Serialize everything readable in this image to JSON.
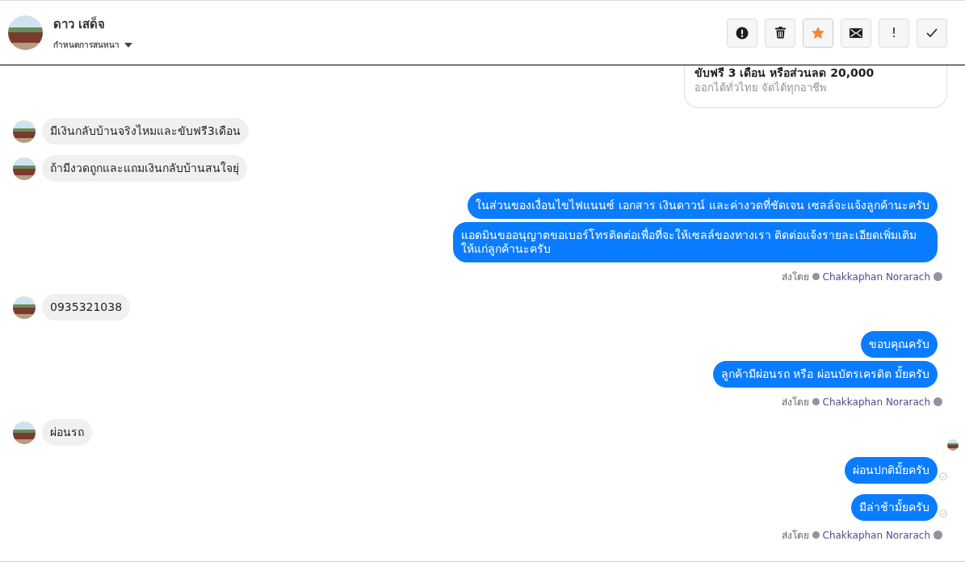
{
  "header": {
    "name": "ดาว เสด็จ",
    "subtitle": "กำหนดการสนทนา",
    "actions": [
      {
        "kind": "alert",
        "on": false
      },
      {
        "kind": "delete",
        "on": false
      },
      {
        "kind": "star",
        "on": true
      },
      {
        "kind": "mail",
        "on": false
      },
      {
        "kind": "important",
        "label": "!",
        "on": false
      },
      {
        "kind": "done",
        "on": false
      }
    ]
  },
  "messages": [
    {
      "kind": "card",
      "title": "ขับฟรี 3 เดือน หรือส่วนลด 20,000",
      "subtitle": "ออกได้ทั่วไทย จัดได้ทุกอาชีพ"
    },
    {
      "kind": "in",
      "text": "มีเงินกลับบ้านจริงไหมและขับฟรี3เดือน"
    },
    {
      "kind": "in",
      "text": "ถ้ามีงวดถูกและแถมเงินกลับบ้านสนใจยุ่"
    },
    {
      "kind": "out",
      "text": "ในส่วนของเงื่อนไขไฟแนนซ์ เอกสาร เงินดาวน์ และค่างวดที่ชัดเจน เซลล์จะแจ้งลูกค้านะครับ",
      "delivered": false
    },
    {
      "kind": "out",
      "text": "แอดมินขออนุญาตขอเบอร์โทรติดต่อเพื่อที่จะให้เซลล์ของทางเรา ติดต่อแจ้งรายละเอียดเพิ่มเติมให้แก่ลูกค้านะครับ",
      "delivered": false
    },
    {
      "kind": "sent_by",
      "prefix": "ส่งโดย",
      "name": "Chakkaphan Norarach"
    },
    {
      "kind": "in",
      "text": "0935321038"
    },
    {
      "kind": "out",
      "text": "ขอบคุณครับ",
      "delivered": false
    },
    {
      "kind": "out",
      "text": "ลูกค้ามีผ่อนรถ หรือ ผ่อนบัตรเครดิต มั้ยครับ",
      "delivered": false
    },
    {
      "kind": "sent_by",
      "prefix": "ส่งโดย",
      "name": "Chakkaphan Norarach"
    },
    {
      "kind": "in",
      "text": "ผ่อนรถ"
    },
    {
      "kind": "seen"
    },
    {
      "kind": "out",
      "text": "ผ่อนปกติมั้ยครับ",
      "delivered": true
    },
    {
      "kind": "out",
      "text": "มีล่าช้ามั้ยครับ",
      "delivered": true
    },
    {
      "kind": "sent_by",
      "prefix": "ส่งโดย",
      "name": "Chakkaphan Norarach"
    }
  ]
}
